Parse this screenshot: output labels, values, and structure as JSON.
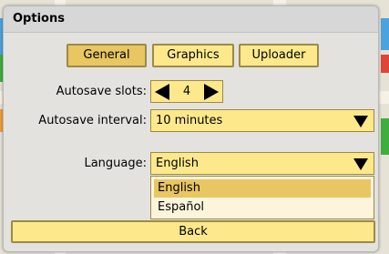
{
  "dialog": {
    "title": "Options"
  },
  "tabs": [
    {
      "label": "General",
      "active": true
    },
    {
      "label": "Graphics",
      "active": false
    },
    {
      "label": "Uploader",
      "active": false
    }
  ],
  "autosave_slots": {
    "label": "Autosave slots:",
    "value": "4"
  },
  "autosave_interval": {
    "label": "Autosave interval:",
    "value": "10 minutes"
  },
  "language": {
    "label": "Language:",
    "value": "English",
    "options": [
      "English",
      "Español"
    ],
    "selected_index": 0
  },
  "back_label": "Back",
  "colors": {
    "button_fill": "#fde98c",
    "button_active": "#e8c661",
    "button_border": "#9d8a44",
    "dialog_bg": "#e4e2df"
  }
}
